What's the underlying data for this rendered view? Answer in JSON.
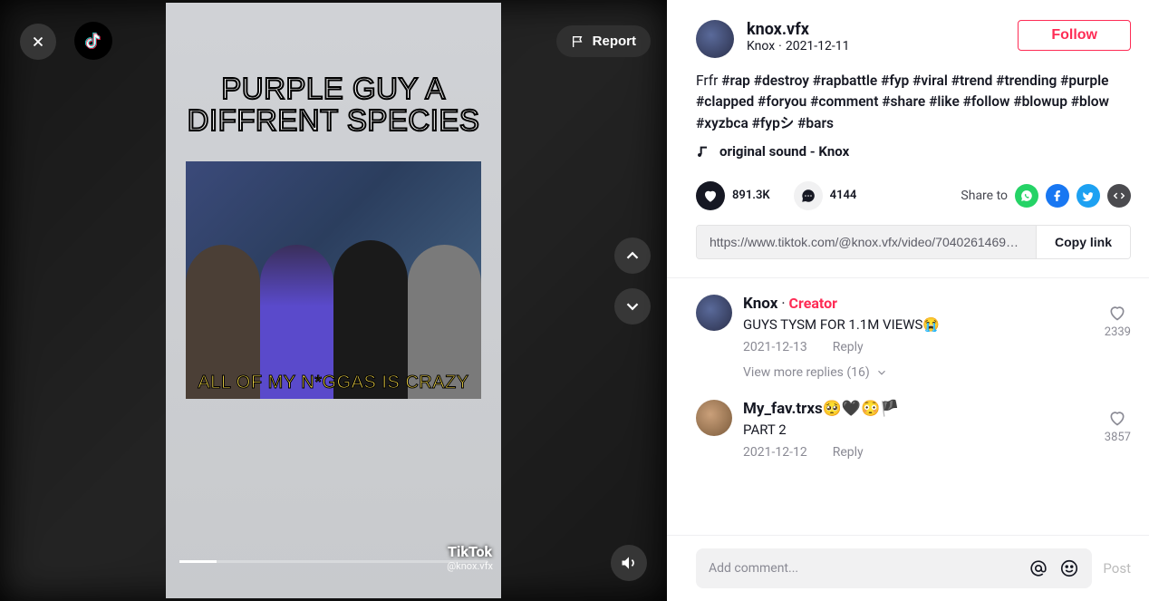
{
  "video": {
    "meme_title_line1": "PURPLE GUY A",
    "meme_title_line2": "DIFFRENT SPECIES",
    "meme_caption": "ALL OF MY N*GGAS IS CRAZY",
    "watermark_brand": "TikTok",
    "watermark_user": "@knox.vfx",
    "report_label": "Report"
  },
  "author": {
    "username": "knox.vfx",
    "display_name": "Knox",
    "date": "2021-12-11",
    "follow_label": "Follow"
  },
  "caption": {
    "text": "Frfr ",
    "tags": "#rap #destroy #rapbattle #fyp #viral #trend #trending #purple #clapped #foryou #comment #share #like #follow #blowup #blow #xyzbca #fypシ #bars"
  },
  "sound": {
    "label": "original sound - Knox"
  },
  "stats": {
    "likes": "891.3K",
    "comments": "4144"
  },
  "share": {
    "label": "Share to",
    "link": "https://www.tiktok.com/@knox.vfx/video/70402614695476...",
    "copy_label": "Copy link"
  },
  "comments": [
    {
      "name": "Knox",
      "is_creator": true,
      "creator_label": "Creator",
      "text": "GUYS TYSM FOR 1.1M VIEWS😭",
      "date": "2021-12-13",
      "reply_label": "Reply",
      "likes": "2339",
      "replies_label": "View more replies (16)"
    },
    {
      "name": "My_fav.trxs🥺🖤😳🏴",
      "is_creator": false,
      "text": "PART 2",
      "date": "2021-12-12",
      "reply_label": "Reply",
      "likes": "3857"
    }
  ],
  "composer": {
    "placeholder": "Add comment...",
    "post_label": "Post"
  }
}
